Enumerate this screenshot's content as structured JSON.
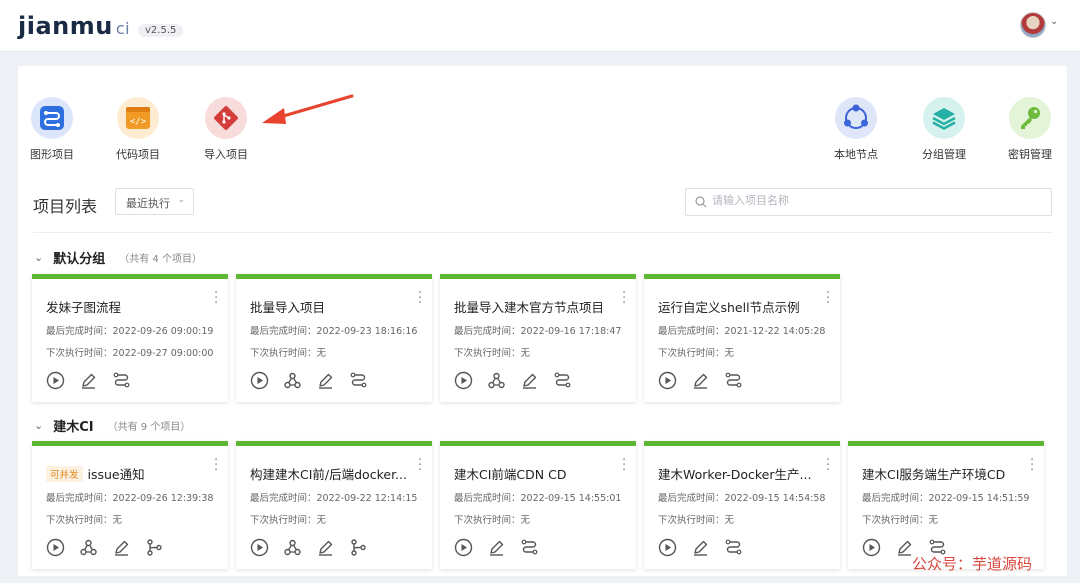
{
  "header": {
    "logo_text": "jianmu",
    "logo_suffix": "ci",
    "version": "v2.5.5"
  },
  "quick_actions_left": [
    {
      "label": "图形项目",
      "icon": "graph-project-icon",
      "color": "#2f6fe0"
    },
    {
      "label": "代码项目",
      "icon": "code-project-icon",
      "color": "#f19a25"
    },
    {
      "label": "导入项目",
      "icon": "git-import-icon",
      "color": "#d43c3c"
    }
  ],
  "quick_actions_right": [
    {
      "label": "本地节点",
      "icon": "local-node-icon",
      "color": "#3a64d8"
    },
    {
      "label": "分组管理",
      "icon": "group-layers-icon",
      "color": "#25b0a6"
    },
    {
      "label": "密钥管理",
      "icon": "key-icon",
      "color": "#6cbb3c"
    }
  ],
  "list": {
    "title": "项目列表",
    "sort_value": "最近执行",
    "search_placeholder": "请输入项目名称"
  },
  "labels": {
    "last_done": "最后完成时间：",
    "next_run": "下次执行时间："
  },
  "groups": [
    {
      "name": "默认分组",
      "count": "（共有 4 个项目）",
      "cards": [
        {
          "name": "发妹子图流程",
          "tag": "",
          "last": "2022-09-26 09:00:19",
          "next": "2022-09-27 09:00:00",
          "actions": [
            "play",
            "edit",
            "flow"
          ]
        },
        {
          "name": "批量导入项目",
          "tag": "",
          "last": "2022-09-23 18:16:16",
          "next": "无",
          "actions": [
            "play",
            "webhook",
            "edit",
            "flow"
          ]
        },
        {
          "name": "批量导入建木官方节点项目",
          "tag": "",
          "last": "2022-09-16 17:18:47",
          "next": "无",
          "actions": [
            "play",
            "webhook",
            "edit",
            "flow"
          ]
        },
        {
          "name": "运行自定义shell节点示例",
          "tag": "",
          "last": "2021-12-22 14:05:28",
          "next": "无",
          "actions": [
            "play",
            "edit",
            "flow"
          ]
        }
      ]
    },
    {
      "name": "建木CI",
      "count": "（共有 9 个项目）",
      "cards": [
        {
          "name": "issue通知",
          "tag": "可并发",
          "last": "2022-09-26 12:39:38",
          "next": "无",
          "actions": [
            "play",
            "webhook",
            "edit",
            "branch"
          ]
        },
        {
          "name": "构建建木CI前/后端docker...",
          "tag": "",
          "last": "2022-09-22 12:14:15",
          "next": "无",
          "actions": [
            "play",
            "webhook",
            "edit",
            "branch"
          ]
        },
        {
          "name": "建木CI前端CDN CD",
          "tag": "",
          "last": "2022-09-15 14:55:01",
          "next": "无",
          "actions": [
            "play",
            "edit",
            "flow"
          ]
        },
        {
          "name": "建木Worker-Docker生产...",
          "tag": "",
          "last": "2022-09-15 14:54:58",
          "next": "无",
          "actions": [
            "play",
            "edit",
            "flow"
          ]
        },
        {
          "name": "建木CI服务端生产环境CD",
          "tag": "",
          "last": "2022-09-15 14:51:59",
          "next": "无",
          "actions": [
            "play",
            "edit",
            "flow"
          ]
        }
      ]
    }
  ],
  "watermark": "公众号：芋道源码",
  "colors": {
    "card_accent": "#5cb832",
    "arrow": "#e8432f",
    "icon_gray": "#555"
  }
}
